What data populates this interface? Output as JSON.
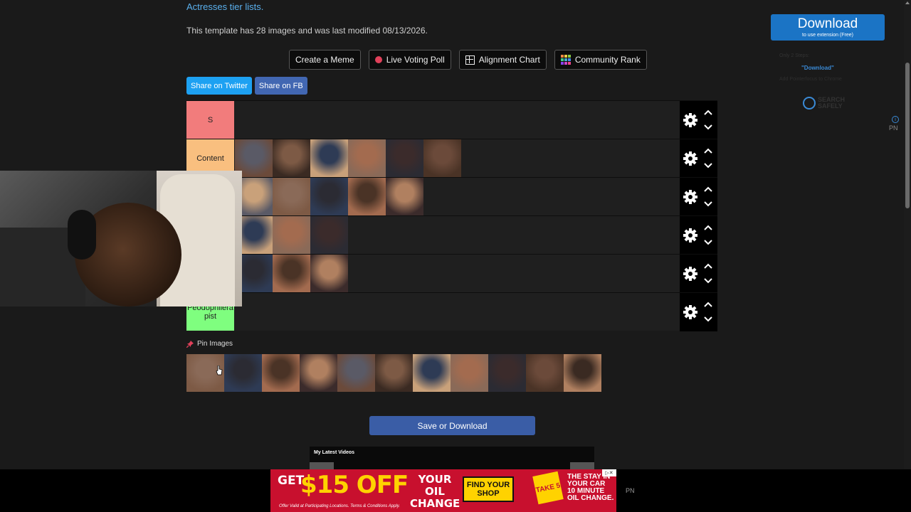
{
  "breadcrumb": {
    "link_text": "Actresses tier lists."
  },
  "template_info": "This template has 28 images and was last modified 08/13/2026.",
  "actions": {
    "create_meme": "Create a Meme",
    "live_voting": "Live Voting Poll",
    "alignment_chart": "Alignment Chart",
    "community_rank": "Community Rank"
  },
  "share": {
    "twitter": "Share on Twitter",
    "facebook": "Share on FB"
  },
  "tiers": [
    {
      "label": "S",
      "color": "#f27c7c",
      "images": 0
    },
    {
      "label": "Content",
      "color": "#f9bf7f",
      "images": 6
    },
    {
      "label": "",
      "color": "#fbdf7f",
      "images": 5
    },
    {
      "label": "",
      "color": "#fdfe7f",
      "images": 3
    },
    {
      "label": "",
      "color": "#bffe7f",
      "images": 3
    },
    {
      "label": "Peodophilera pist",
      "color": "#7ffe7f",
      "images": 0
    }
  ],
  "pin": {
    "label": "Pin Images",
    "image_count": 11
  },
  "save_button": "Save or Download",
  "videos": {
    "title": "My Latest Videos"
  },
  "ad": {
    "get": "GET",
    "offer": "$15 OFF",
    "your_oil_change": "YOUR OIL CHANGE",
    "find_shop": "FIND YOUR SHOP",
    "badge": "TAKE 5",
    "tagline": "THE STAY IN YOUR CAR 10 MINUTE OIL CHANGE.",
    "fine_print": "Offer Valid at Participating Locations. Terms & Conditions Apply."
  },
  "sidebar": {
    "download_title": "Download",
    "download_sub": "to use extension (Free)",
    "ext_line1": "Only 2 Steps:",
    "ext_line2": "\"Download\"",
    "ext_line3": "Add Pointerfocus to Chrome",
    "search_safely": "SEARCH SAFELY",
    "pn": "PN"
  },
  "bottom_pn": "PN",
  "icons": {
    "gear": "gear-icon",
    "chevron_up": "chevron-up-icon",
    "chevron_down": "chevron-down-icon",
    "pin": "pin-icon",
    "grid": "grid-icon"
  }
}
